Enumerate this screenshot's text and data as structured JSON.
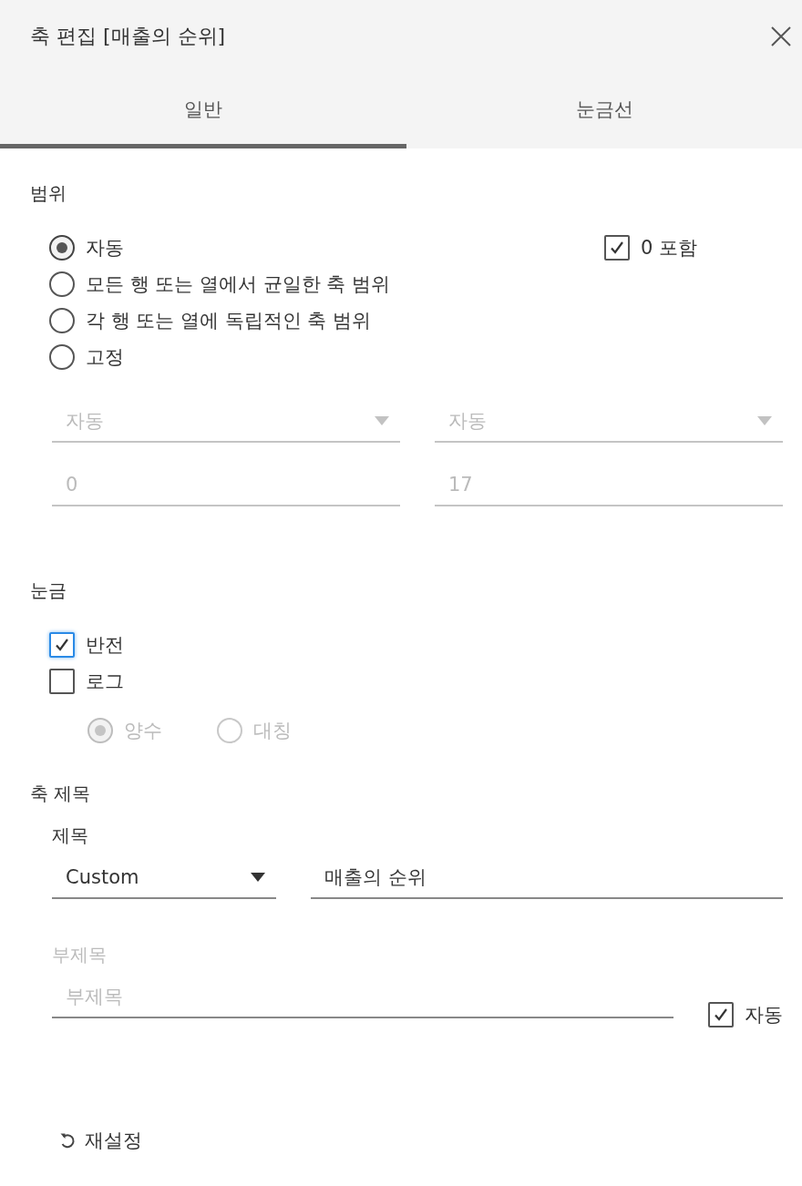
{
  "dialog": {
    "title": "축 편집 [매출의 순위]"
  },
  "tabs": [
    {
      "label": "일반",
      "selected": true
    },
    {
      "label": "눈금선",
      "selected": false
    }
  ],
  "range": {
    "heading": "범위",
    "options": [
      {
        "label": "자동",
        "selected": true
      },
      {
        "label": "모든 행 또는 열에서 균일한 축 범위",
        "selected": false
      },
      {
        "label": "각 행 또는 열에 독립적인 축 범위",
        "selected": false
      },
      {
        "label": "고정",
        "selected": false
      }
    ],
    "include_zero": {
      "label": "0 포함",
      "checked": true
    },
    "dropdowns": [
      {
        "value": "자동",
        "disabled": true
      },
      {
        "value": "자동",
        "disabled": true
      }
    ],
    "fields": [
      {
        "value": "0",
        "disabled": true
      },
      {
        "value": "17",
        "disabled": true
      }
    ]
  },
  "scale": {
    "heading": "눈금",
    "options": [
      {
        "label": "반전",
        "checked": true,
        "focused": true
      },
      {
        "label": "로그",
        "checked": false,
        "focused": false
      }
    ],
    "log_modes": [
      {
        "label": "양수",
        "selected": true,
        "disabled": true
      },
      {
        "label": "대칭",
        "selected": false,
        "disabled": true
      }
    ]
  },
  "axis_title": {
    "heading": "축 제목",
    "title_label": "제목",
    "title_source": {
      "value": "Custom"
    },
    "title_field": {
      "value": "매출의 순위"
    },
    "subtitle_label": {
      "text": "부제목",
      "disabled": true
    },
    "subtitle_field": {
      "placeholder": "부제목"
    },
    "subtitle_auto": {
      "label": "자동",
      "checked": true
    }
  },
  "reset": {
    "label": "재설정"
  }
}
